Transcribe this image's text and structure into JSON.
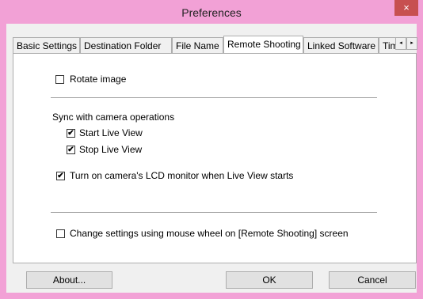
{
  "window": {
    "title": "Preferences",
    "close_glyph": "×"
  },
  "tabs": [
    {
      "label": "Basic Settings"
    },
    {
      "label": "Destination Folder"
    },
    {
      "label": "File Name"
    },
    {
      "label": "Remote Shooting"
    },
    {
      "label": "Linked Software"
    },
    {
      "label": "Tim"
    }
  ],
  "tab_scroll": {
    "left_glyph": "◂",
    "right_glyph": "▸"
  },
  "options": {
    "rotate_image": {
      "label": "Rotate image",
      "checked": false
    },
    "sync_heading": "Sync with camera operations",
    "start_live_view": {
      "label": "Start Live View",
      "checked": true
    },
    "stop_live_view": {
      "label": "Stop Live View",
      "checked": true
    },
    "lcd_monitor": {
      "label": "Turn on camera's LCD monitor when Live View starts",
      "checked": true
    },
    "mouse_wheel": {
      "label": "Change settings using mouse wheel on [Remote Shooting] screen",
      "checked": false
    }
  },
  "check_glyph": "✔",
  "buttons": {
    "about": "About...",
    "ok": "OK",
    "cancel": "Cancel"
  },
  "colors": {
    "titlebar": "#f2a1d6",
    "close": "#c75050"
  }
}
